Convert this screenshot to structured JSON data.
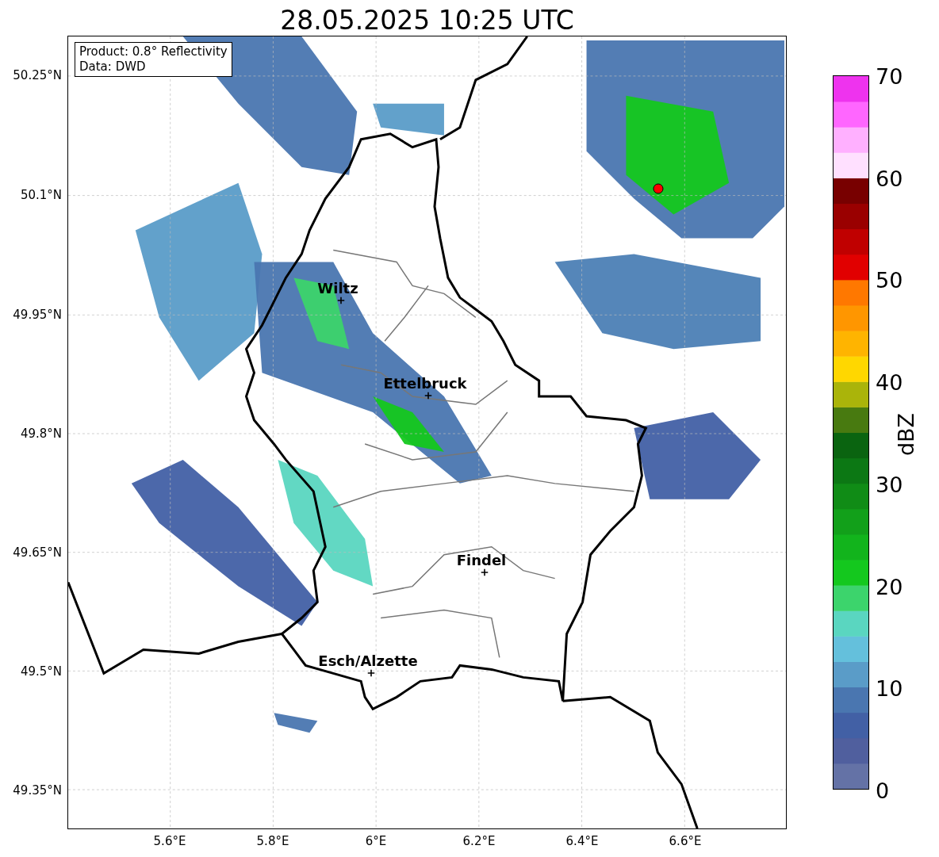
{
  "title": "28.05.2025 10:25 UTC",
  "info": [
    "Product: 0.8° Reflectivity",
    "Data: DWD"
  ],
  "cities": [
    {
      "name": "Wiltz"
    },
    {
      "name": "Ettelbruck"
    },
    {
      "name": "Findel"
    },
    {
      "name": "Esch/Alzette"
    }
  ],
  "y_ticks": [
    "50.25°N",
    "50.1°N",
    "49.95°N",
    "49.8°N",
    "49.65°N",
    "49.5°N",
    "49.35°N"
  ],
  "x_ticks": [
    "5.6°E",
    "5.8°E",
    "6°E",
    "6.2°E",
    "6.4°E",
    "6.6°E"
  ],
  "colorbar": {
    "label": "dBZ",
    "ticks": [
      "70",
      "60",
      "50",
      "40",
      "30",
      "20",
      "10",
      "0"
    ]
  }
}
